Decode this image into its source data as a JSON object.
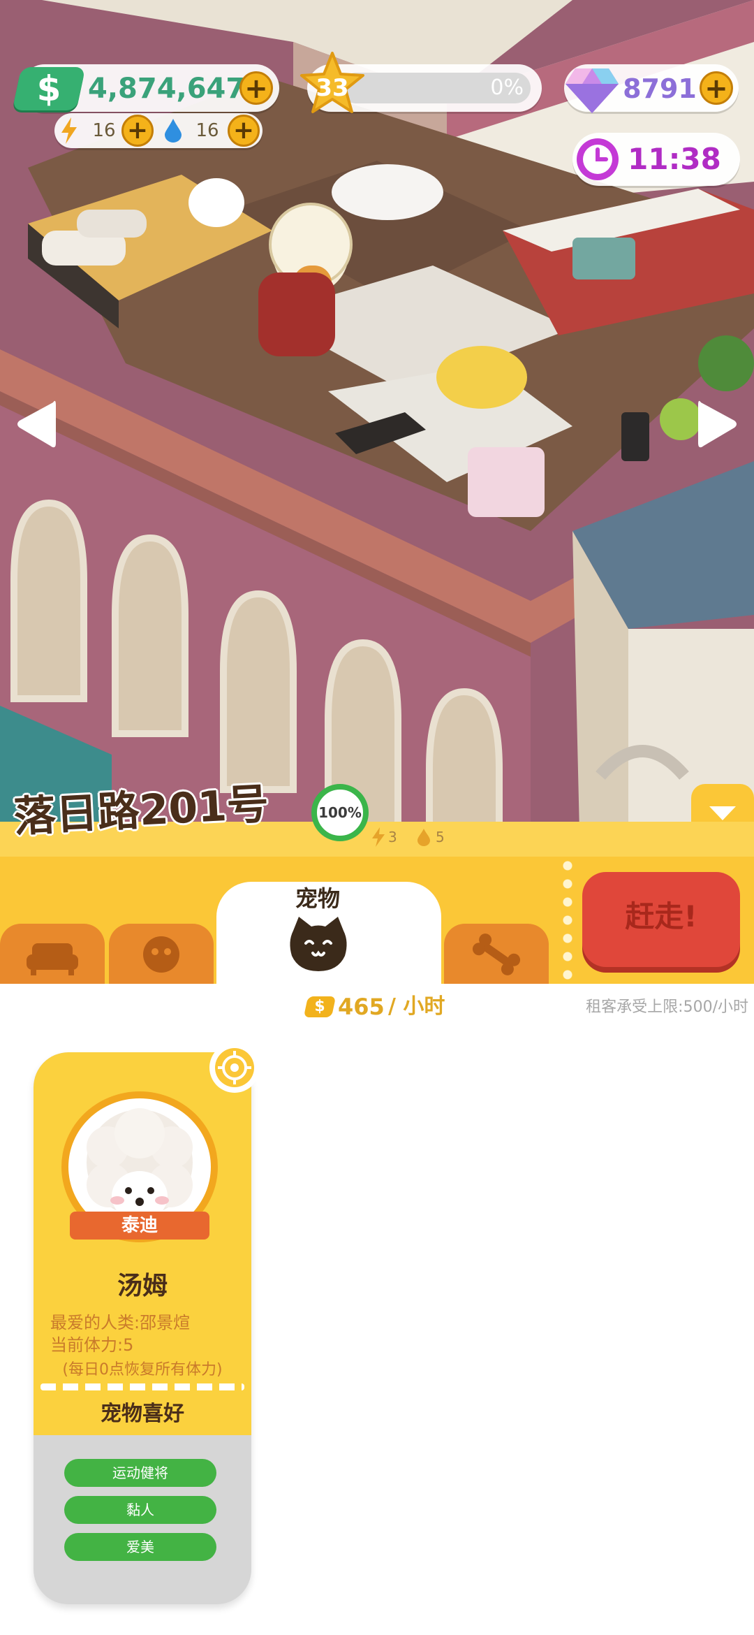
{
  "hud": {
    "money": "4,874,647",
    "energy": "16",
    "water": "16",
    "level": "33",
    "level_progress_text": "0%",
    "level_progress": 0,
    "gems": "8791",
    "time": "11:38",
    "money_icon": "dollar-icon",
    "plus_icon": "plus-icon"
  },
  "building": {
    "name": "落日路201号",
    "completion": "100%",
    "stat_energy": "3",
    "stat_water": "5"
  },
  "tabs": {
    "active_label": "宠物"
  },
  "evict_button": "赶走!",
  "income": {
    "value": "465",
    "unit": "/ 小时",
    "limit_text": "租客承受上限:500/小时"
  },
  "pet_card": {
    "breed": "泰迪",
    "name": "汤姆",
    "favorite": "最爱的人类:邵景煊",
    "stamina": "当前体力:5",
    "recover_note": "(每日0点恢复所有体力)",
    "prefs_title": "宠物喜好",
    "prefs": [
      "运动健将",
      "黏人",
      "爱美"
    ]
  },
  "colors": {
    "panel_yellow": "#fbc737",
    "tab_orange": "#e8892c",
    "evict_red": "#e0473a",
    "pref_green": "#43b344",
    "gem_purple": "#8c6fd8"
  }
}
